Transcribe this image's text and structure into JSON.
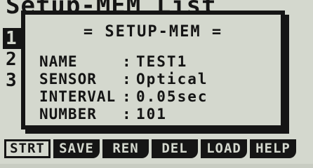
{
  "background": {
    "title": "Setup-MEM List",
    "rows": [
      "1",
      "2",
      "3"
    ]
  },
  "dialog": {
    "title": "= SETUP-MEM =",
    "separator": ":",
    "fields": [
      {
        "label": "NAME",
        "value": "TEST1"
      },
      {
        "label": "SENSOR",
        "value": "Optical"
      },
      {
        "label": "INTERVAL",
        "value": "0.05sec"
      },
      {
        "label": "NUMBER",
        "value": "101"
      }
    ]
  },
  "function_keys": [
    {
      "label": "STRT"
    },
    {
      "label": "SAVE"
    },
    {
      "label": "REN"
    },
    {
      "label": "DEL"
    },
    {
      "label": "LOAD"
    },
    {
      "label": "HELP"
    }
  ],
  "colors": {
    "lcd_background": "#d4d8ce",
    "pixel_dark": "#151515"
  }
}
